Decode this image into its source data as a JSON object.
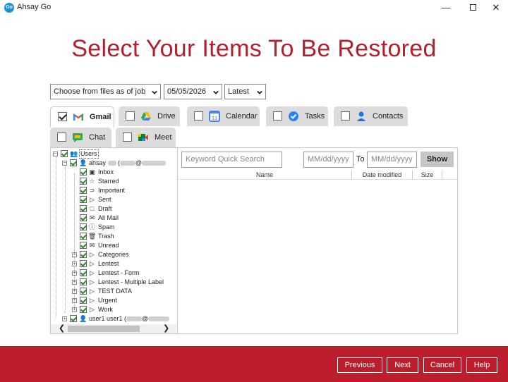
{
  "window": {
    "title": "Ahsay Go",
    "logo_text": "Go",
    "min_icon": "minimize-icon",
    "max_icon": "maximize-icon",
    "close_icon": "close-icon"
  },
  "page_title": "Select Your Items To Be Restored",
  "filters": {
    "mode": "Choose from files as of job",
    "date": "05/05/2026",
    "version": "Latest"
  },
  "tabs": [
    {
      "label": "Gmail",
      "checked": true,
      "active": true,
      "icon": "gmail-icon"
    },
    {
      "label": "Drive",
      "checked": false,
      "active": false,
      "icon": "drive-icon"
    },
    {
      "label": "Calendar",
      "checked": false,
      "active": false,
      "icon": "calendar-icon"
    },
    {
      "label": "Tasks",
      "checked": false,
      "active": false,
      "icon": "tasks-icon"
    },
    {
      "label": "Contacts",
      "checked": false,
      "active": false,
      "icon": "contacts-icon"
    },
    {
      "label": "Chat",
      "checked": false,
      "active": false,
      "icon": "chat-icon"
    },
    {
      "label": "Meet",
      "checked": false,
      "active": false,
      "icon": "meet-icon"
    }
  ],
  "tree": {
    "root": "Users",
    "user1_name": "ahsay",
    "user1_at": "@",
    "folders": [
      "Inbox",
      "Starred",
      "Important",
      "Sent",
      "Draft",
      "All Mail",
      "Spam",
      "Trash",
      "Unread"
    ],
    "labels": [
      "Categories",
      "Lentest",
      "Lentest - Form",
      "Lentest - Multiple Label",
      "TEST DATA",
      "Urgent",
      "Work"
    ],
    "user2_name": "user1 user1 (",
    "user2_at": "@"
  },
  "search": {
    "placeholder": "Keyword Quick Search",
    "from_placeholder": "MM/dd/yyyy",
    "to_label": "To",
    "to_placeholder": "MM/dd/yyyy",
    "show_label": "Show"
  },
  "columns": [
    "Name",
    "Date modified",
    "Size"
  ],
  "footer": {
    "previous": "Previous",
    "next": "Next",
    "cancel": "Cancel",
    "help": "Help"
  },
  "colors": {
    "brand_red": "#bd1e2d",
    "title_red": "#b3202d"
  }
}
